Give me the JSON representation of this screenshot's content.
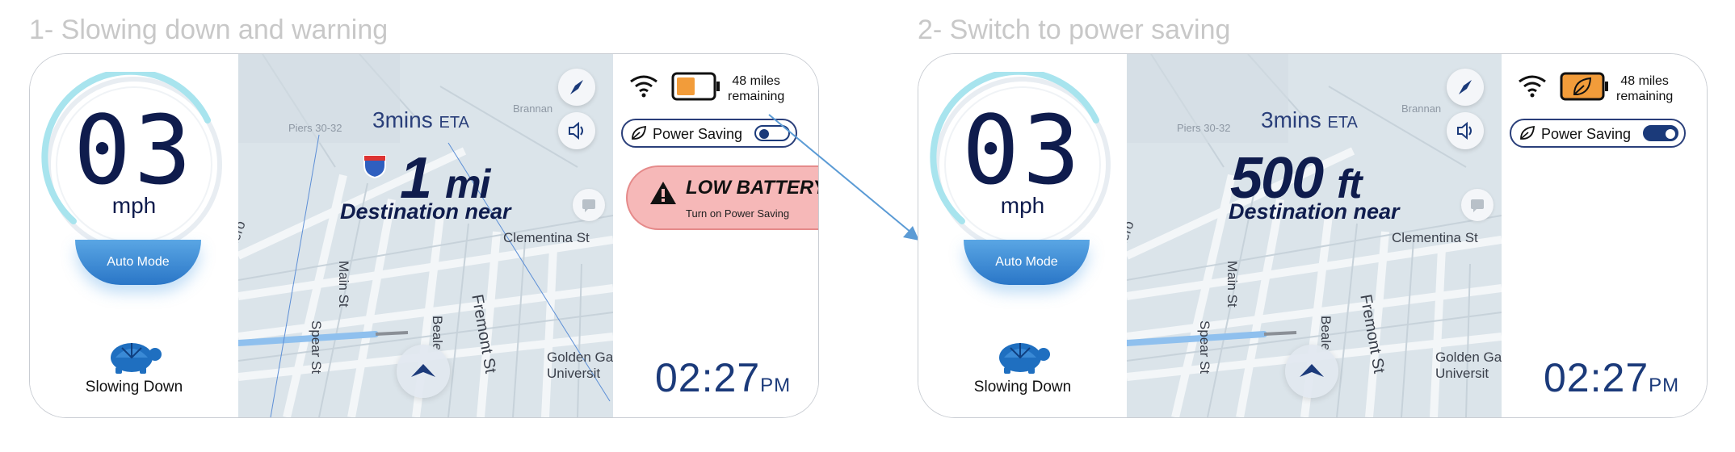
{
  "panels": [
    {
      "title": "1- Slowing down and warning",
      "speed": "03",
      "speed_unit": "mph",
      "mode": "Auto Mode",
      "status": "Slowing Down",
      "eta_value": "3mins",
      "eta_suffix": "ETA",
      "distance_value": "1",
      "distance_unit": "mi",
      "destination": "Destination near",
      "miles_line1": "48 miles",
      "miles_line2": "remaining",
      "power_saving_label": "Power Saving",
      "power_saving_on": false,
      "alert_title": "LOW BATTERY",
      "alert_subtitle": "Turn on Power Saving",
      "time": "02:27",
      "ampm": "PM",
      "battery_color": "#f29c3a"
    },
    {
      "title": "2- Switch to power saving",
      "speed": "03",
      "speed_unit": "mph",
      "mode": "Auto Mode",
      "status": "Slowing Down",
      "eta_value": "3mins",
      "eta_suffix": "ETA",
      "distance_value": "500",
      "distance_unit": "ft",
      "destination": "Destination near",
      "miles_line1": "48 miles",
      "miles_line2": "remaining",
      "power_saving_label": "Power Saving",
      "power_saving_on": true,
      "time": "02:27",
      "ampm": "PM",
      "battery_color": "#f29c3a"
    }
  ],
  "map_labels": {
    "street_clementina": "Clementina St",
    "street_main": "Main St",
    "street_spear": "Spear St",
    "street_beale": "Beale",
    "street_fremont": "Fremont St",
    "street_embarcadero": "Embarcadero",
    "poi_golden_gate_1": "Golden Ga",
    "poi_golden_gate_2": "Universit",
    "highway_shield": "80",
    "pier_label": "Piers 30-32",
    "brannan_label": "Brannan"
  },
  "colors": {
    "accent": "#1b3a7a",
    "alert_bg": "#f6b8b8",
    "route_blue": "#7fb4ea",
    "arrow": "#5b9bd5"
  }
}
